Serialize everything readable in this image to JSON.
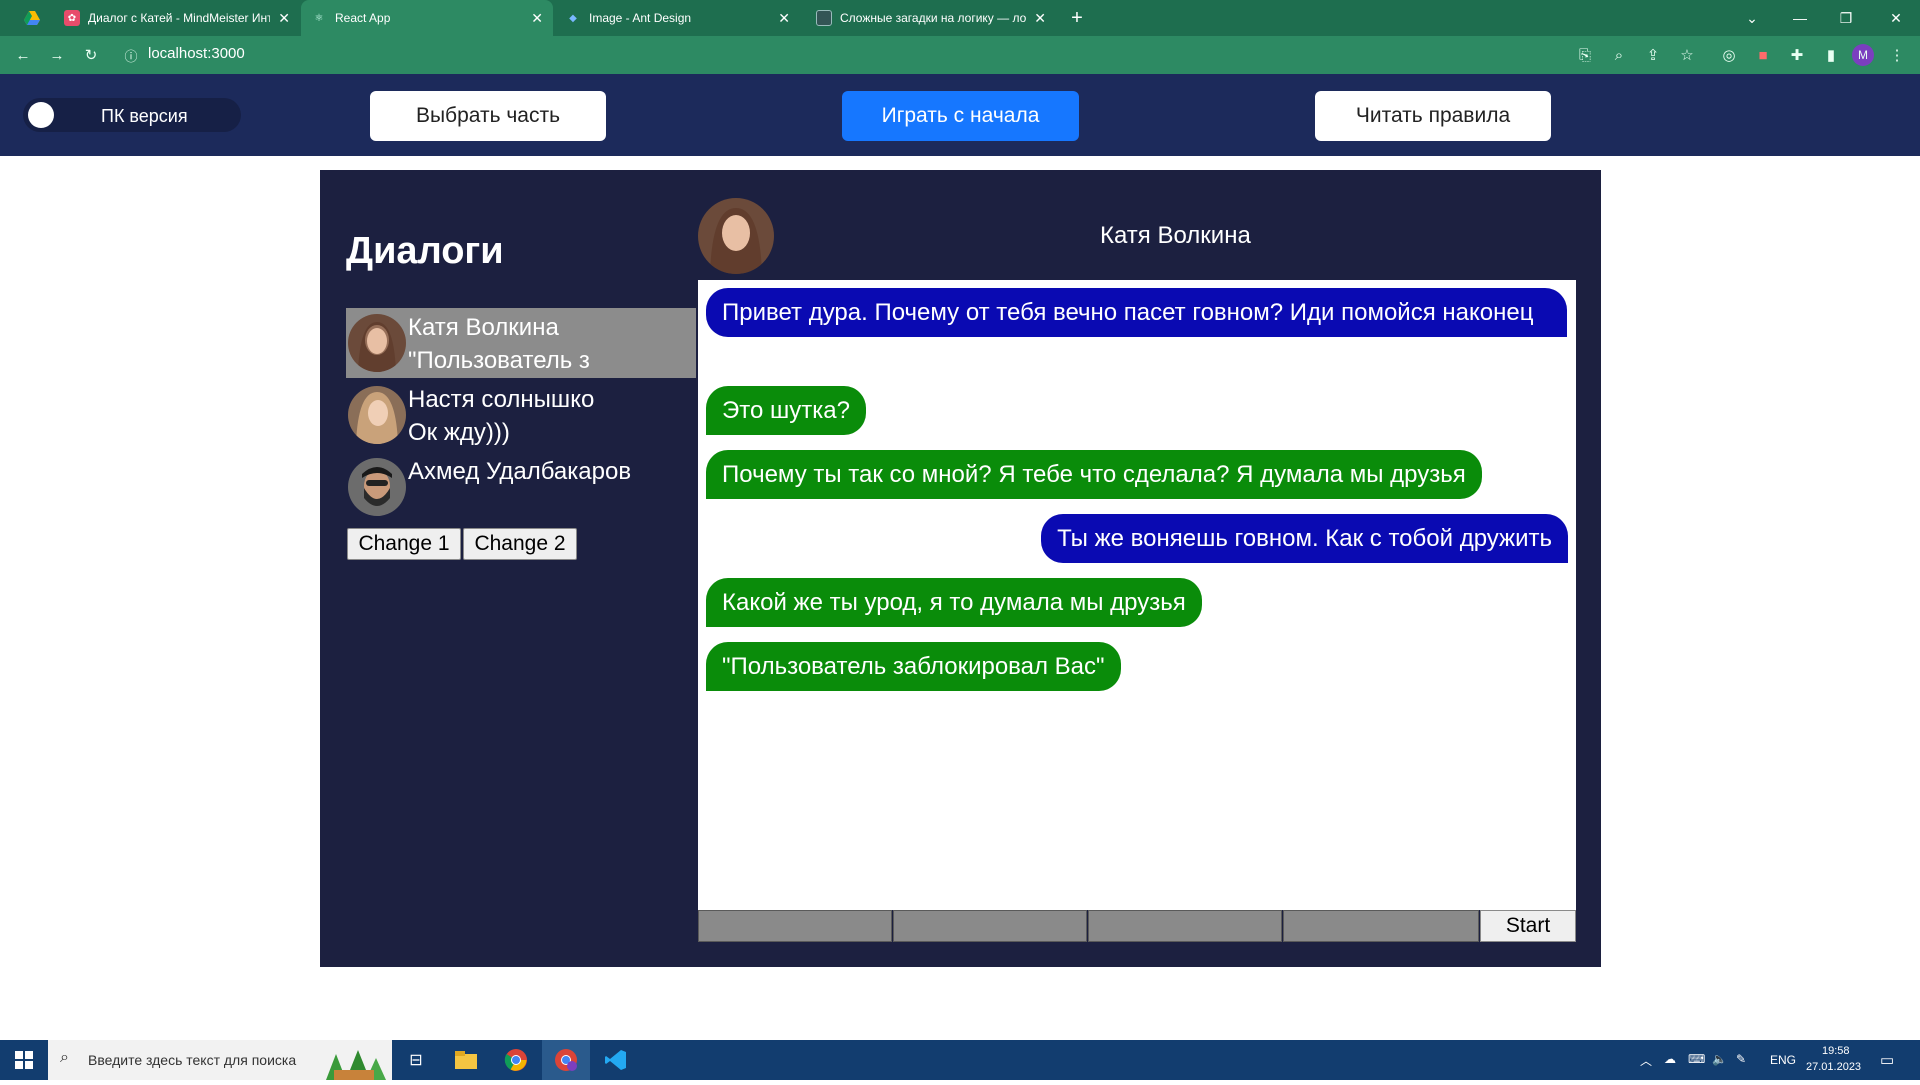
{
  "browser": {
    "tabs": [
      {
        "title": "Диалог с Катей - MindMeister Инте",
        "icon": "mindmeister-icon",
        "active": false
      },
      {
        "title": "React App",
        "icon": "react-icon",
        "active": true
      },
      {
        "title": "Image - Ant Design",
        "icon": "antd-icon",
        "active": false
      },
      {
        "title": "Сложные загадки на логику — лог",
        "icon": "page-icon",
        "active": false
      }
    ],
    "url": "localhost:3000",
    "profile_initial": "M"
  },
  "header": {
    "toggle_label": "ПК версия",
    "choose_part": "Выбрать часть",
    "restart": "Играть с начала",
    "rules": "Читать правила",
    "accent": "#1677ff"
  },
  "sidebar": {
    "title": "Диалоги",
    "dialogs": [
      {
        "name": "Катя Волкина",
        "last": "\"Пользователь з",
        "selected": true
      },
      {
        "name": "Настя солнышко",
        "last": "Ок жду)))",
        "selected": false
      },
      {
        "name": "Ахмед Удалбакаров",
        "last": "",
        "selected": false
      }
    ],
    "change1": "Change 1",
    "change2": "Change 2"
  },
  "chat": {
    "contact_name": "Катя Волкина",
    "messages": [
      {
        "text": "Привет дура. Почему от тебя вечно пасет говном? Иди помойся наконец",
        "color": "#0a0ab2",
        "side": "left"
      },
      {
        "text": "Это шутка?",
        "color": "#0a8c0a",
        "side": "left"
      },
      {
        "text": "Почему ты так со мной? Я тебе что сделала? Я думала мы друзья",
        "color": "#0a8c0a",
        "side": "left"
      },
      {
        "text": "Ты же воняешь говном. Как с тобой дружить",
        "color": "#0a0ab2",
        "side": "right"
      },
      {
        "text": "Какой же ты урод, я то думала мы друзья",
        "color": "#0a8c0a",
        "side": "left"
      },
      {
        "text": "\"Пользователь заблокировал Вас\"",
        "color": "#0a8c0a",
        "side": "left"
      }
    ],
    "start_label": "Start"
  },
  "taskbar": {
    "search_placeholder": "Введите здесь текст для поиска",
    "lang": "ENG",
    "time": "19:58",
    "date": "27.01.2023"
  }
}
